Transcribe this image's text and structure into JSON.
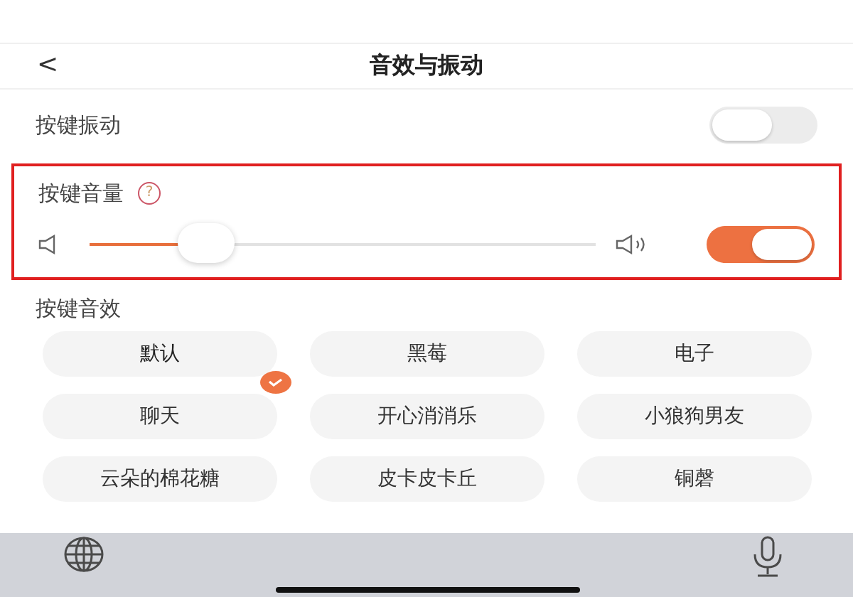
{
  "header": {
    "back": "<",
    "title": "音效与振动"
  },
  "vibration": {
    "label": "按键振动",
    "on": false
  },
  "volume": {
    "label": "按键音量",
    "help": "?",
    "highlighted": true,
    "level": 0.23,
    "on": true
  },
  "sound_effects": {
    "title": "按键音效",
    "items": [
      {
        "label": "默认",
        "selected": true
      },
      {
        "label": "黑莓",
        "selected": false
      },
      {
        "label": "电子",
        "selected": false
      },
      {
        "label": "聊天",
        "selected": false
      },
      {
        "label": "开心消消乐",
        "selected": false
      },
      {
        "label": "小狼狗男友",
        "selected": false
      },
      {
        "label": "云朵的棉花糖",
        "selected": false
      },
      {
        "label": "皮卡皮卡丘",
        "selected": false
      },
      {
        "label": "铜磬",
        "selected": false
      }
    ]
  }
}
